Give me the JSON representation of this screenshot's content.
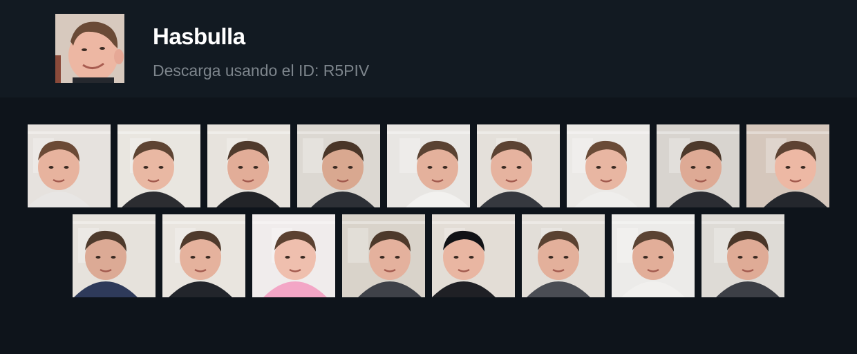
{
  "pack": {
    "title": "Hasbulla",
    "subtitle": "Descarga usando el ID: R5PIV"
  },
  "colors": {
    "header_bg": "#121a22",
    "page_bg": "#0e141b",
    "title": "#ffffff",
    "subtitle": "#7d858c"
  },
  "stickers_row1": [
    {
      "bg": "#e6e2de",
      "shirt": "#e8e6e4",
      "skin": "#e7b39e",
      "hair": "#6b4a36"
    },
    {
      "bg": "#e9e6e0",
      "shirt": "#2c2d31",
      "skin": "#e9b8a3",
      "hair": "#5e4433"
    },
    {
      "bg": "#e7e3dd",
      "shirt": "#222428",
      "skin": "#e2ad98",
      "hair": "#4f3a2c"
    },
    {
      "bg": "#dcd8d2",
      "shirt": "#2d3036",
      "skin": "#d9a890",
      "hair": "#4a3628"
    },
    {
      "bg": "#e8e6e3",
      "shirt": "#f2f1ef",
      "skin": "#e4b19c",
      "hair": "#5a4232"
    },
    {
      "bg": "#e4e0da",
      "shirt": "#36393f",
      "skin": "#e6b39f",
      "hair": "#5c4333"
    },
    {
      "bg": "#ebe9e6",
      "shirt": "#efeeec",
      "skin": "#e8b6a2",
      "hair": "#6a4b37"
    },
    {
      "bg": "#d8d4cf",
      "shirt": "#2b2d33",
      "skin": "#deaa95",
      "hair": "#4d392b"
    },
    {
      "bg": "#d5c7bc",
      "shirt": "#24272d",
      "skin": "#edb8a4",
      "hair": "#5d4232"
    }
  ],
  "stickers_row2": [
    {
      "bg": "#e6e2dc",
      "shirt": "#2e3a5a",
      "skin": "#dcaa95",
      "hair": "#4e3a2c"
    },
    {
      "bg": "#e9e5df",
      "shirt": "#22252b",
      "skin": "#e5b29d",
      "hair": "#4f3a2c"
    },
    {
      "bg": "#f0ecec",
      "shirt": "#f3a6c6",
      "skin": "#efbfae",
      "hair": "#5b4131"
    },
    {
      "bg": "#d9d3ca",
      "shirt": "#3f4249",
      "skin": "#e4b19d",
      "hair": "#4d392b"
    },
    {
      "bg": "#e3ddd6",
      "shirt": "#1f2025",
      "skin": "#e9b6a2",
      "hair": "#111216"
    },
    {
      "bg": "#e2ded8",
      "shirt": "#4a4d54",
      "skin": "#e3b09b",
      "hair": "#5a4232"
    },
    {
      "bg": "#ecebe9",
      "shirt": "#f1f0ee",
      "skin": "#e2ae99",
      "hair": "#5b4333"
    },
    {
      "bg": "#dedbd6",
      "shirt": "#3c3f46",
      "skin": "#dfab96",
      "hair": "#4a3628"
    }
  ]
}
